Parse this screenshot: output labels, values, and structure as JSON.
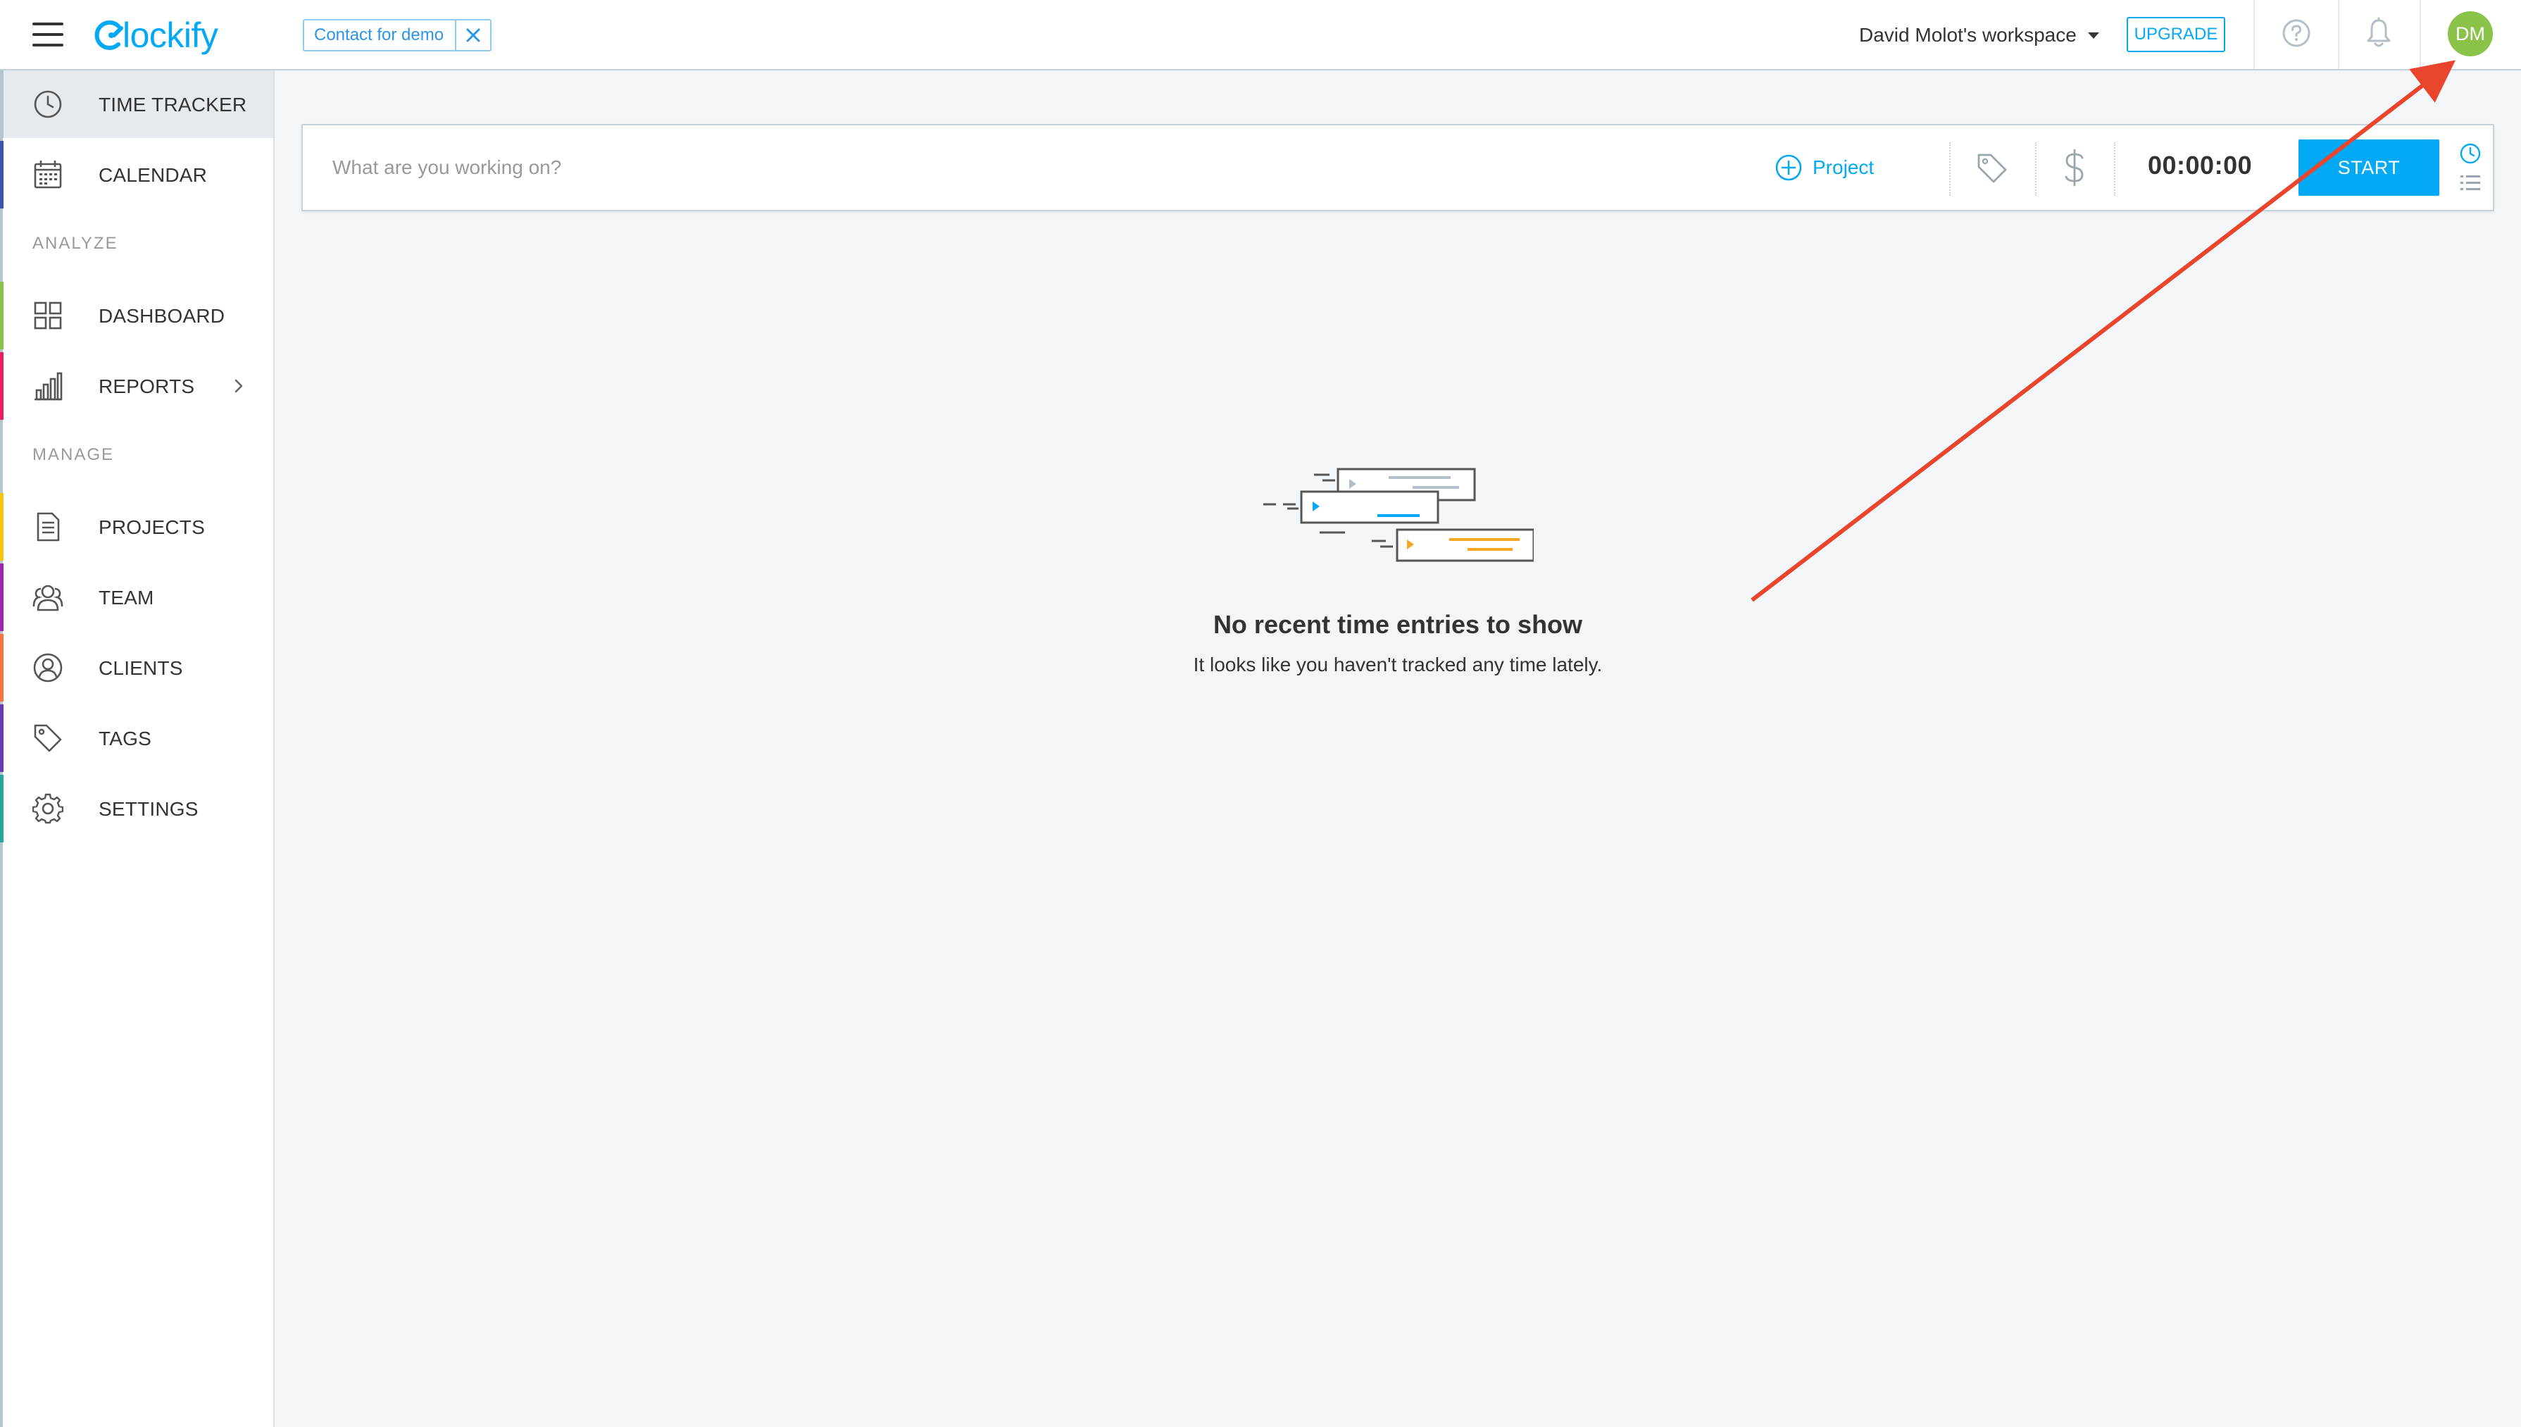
{
  "brand": {
    "logo_text": "lockify",
    "accent_color": "#03a9f4"
  },
  "header": {
    "demo_chip_label": "Contact for demo",
    "workspace_label": "David Molot's workspace",
    "upgrade_label": "UPGRADE",
    "avatar_initials": "DM",
    "avatar_color": "#8bc34a",
    "icons": [
      "menu-icon",
      "close-icon",
      "chevron-down-icon",
      "help-icon",
      "bell-icon"
    ]
  },
  "sidebar": {
    "items": [
      {
        "label": "TIME TRACKER",
        "icon": "clock-icon",
        "stripe_color": "#b8c4cc",
        "active": true
      },
      {
        "label": "CALENDAR",
        "icon": "calendar-icon",
        "stripe_color": "#3f51b5",
        "active": false
      }
    ],
    "section_analyze": "ANALYZE",
    "analyze_items": [
      {
        "label": "DASHBOARD",
        "icon": "dashboard-icon",
        "stripe_color": "#8bc34a"
      },
      {
        "label": "REPORTS",
        "icon": "reports-icon",
        "stripe_color": "#e91e63"
      }
    ],
    "section_manage": "MANAGE",
    "manage_items": [
      {
        "label": "PROJECTS",
        "icon": "projects-icon",
        "stripe_color": "#ffc107"
      },
      {
        "label": "TEAM",
        "icon": "team-icon",
        "stripe_color": "#9c27b0"
      },
      {
        "label": "CLIENTS",
        "icon": "clients-icon",
        "stripe_color": "#ff7043"
      },
      {
        "label": "TAGS",
        "icon": "tag-icon",
        "stripe_color": "#673ab7"
      },
      {
        "label": "SETTINGS",
        "icon": "gear-icon",
        "stripe_color": "#26a69a"
      }
    ]
  },
  "timer": {
    "placeholder": "What are you working on?",
    "project_label": "Project",
    "duration": "00:00:00",
    "start_label": "START"
  },
  "empty_state": {
    "title": "No recent time entries to show",
    "subtitle": "It looks like you haven't tracked any time lately."
  },
  "annotation": {
    "arrow_color": "#e8452c"
  }
}
